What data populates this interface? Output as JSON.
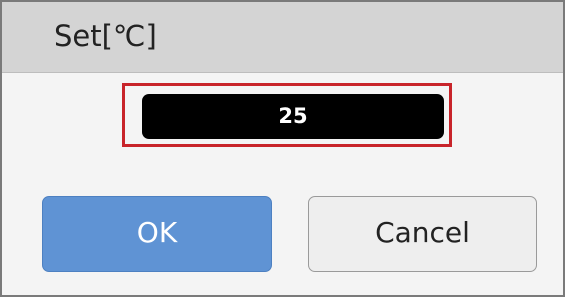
{
  "dialog": {
    "title": "Set[℃]",
    "value": "25",
    "buttons": {
      "ok_label": "OK",
      "cancel_label": "Cancel"
    }
  },
  "colors": {
    "title_bar": "#d4d4d4",
    "dialog_background": "#f4f4f4",
    "value_background": "#000000",
    "value_text": "#ffffff",
    "highlight_border": "#c8242a",
    "ok_button": "#5f93d4",
    "cancel_button": "#eeeeee"
  }
}
